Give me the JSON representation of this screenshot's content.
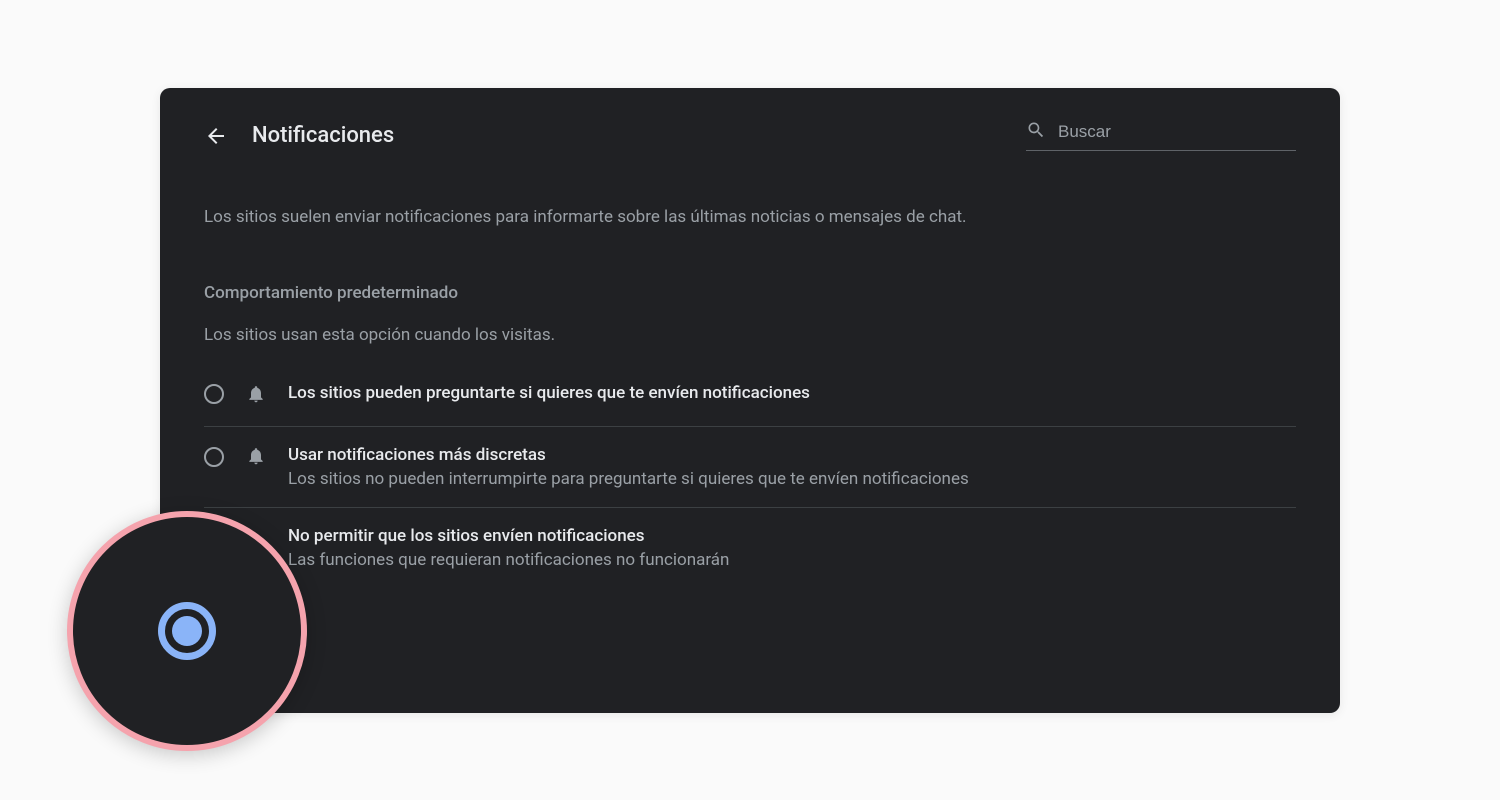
{
  "header": {
    "title": "Notificaciones",
    "search_placeholder": "Buscar"
  },
  "intro": "Los sitios suelen enviar notificaciones para informarte sobre las últimas noticias o mensajes de chat.",
  "section": {
    "heading": "Comportamiento predeterminado",
    "subtext": "Los sitios usan esta opción cuando los visitas."
  },
  "options": [
    {
      "title": "Los sitios pueden preguntarte si quieres que te envíen notificaciones",
      "description": null,
      "selected": false,
      "has_icon": true
    },
    {
      "title": "Usar notificaciones más discretas",
      "description": "Los sitios no pueden interrumpirte para preguntarte si quieres que te envíen notificaciones",
      "selected": false,
      "has_icon": true
    },
    {
      "title": "No permitir que los sitios envíen notificaciones",
      "description": "Las funciones que requieran notificaciones no funcionarán",
      "selected": true,
      "has_icon": false
    }
  ]
}
